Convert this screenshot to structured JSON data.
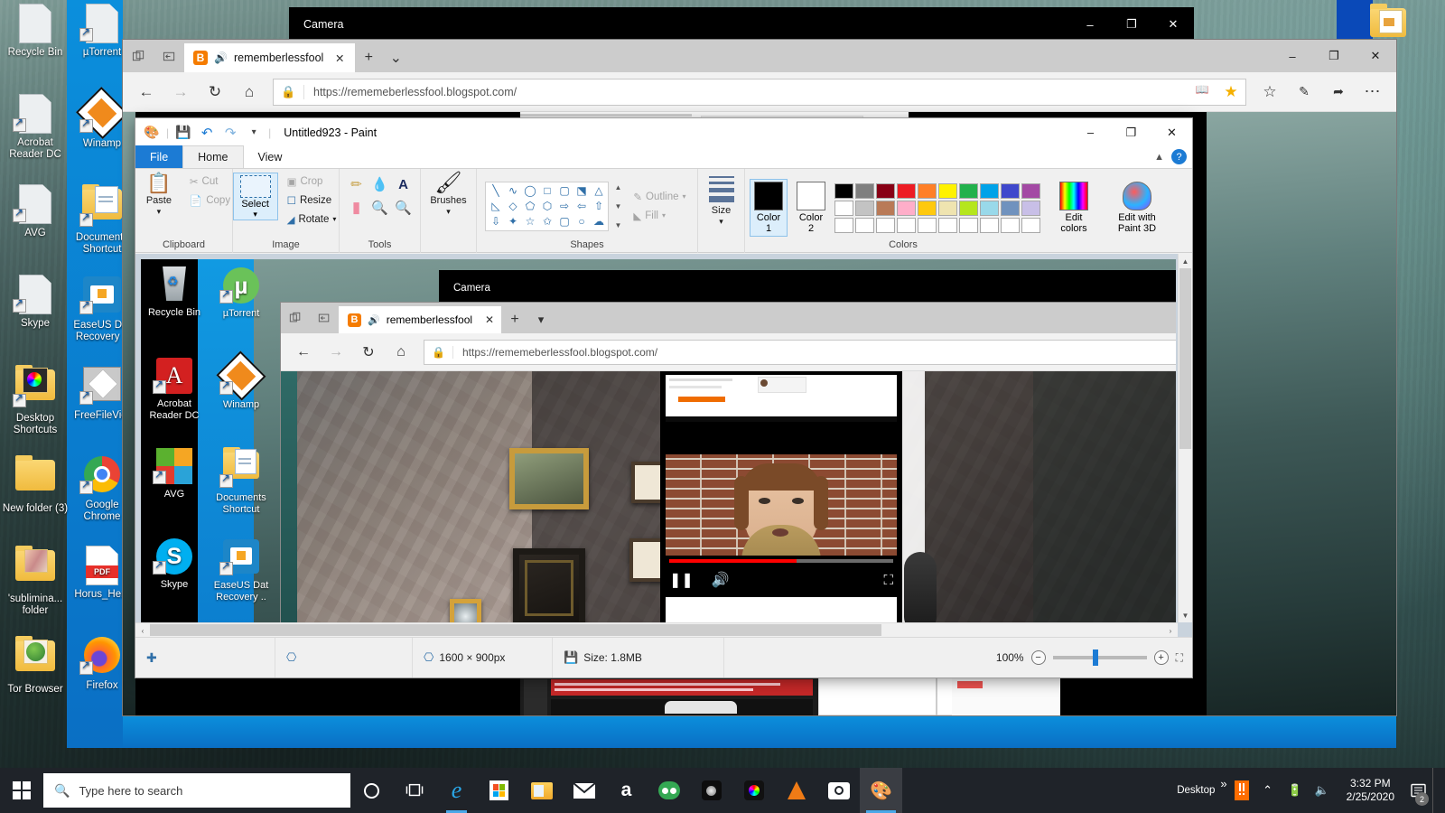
{
  "desktop": {
    "icons_col1": [
      {
        "label": "Recycle Bin",
        "icon": "recycle-bin-icon"
      },
      {
        "label": "Acrobat Reader DC",
        "icon": "acrobat-reader-icon"
      },
      {
        "label": "AVG",
        "icon": "avg-icon"
      },
      {
        "label": "Skype",
        "icon": "skype-icon"
      },
      {
        "label": "Desktop Shortcuts",
        "icon": "folder-icon"
      },
      {
        "label": "New folder (3)",
        "icon": "folder-icon"
      },
      {
        "label": "'sublimina... folder",
        "icon": "folder-icon"
      },
      {
        "label": "Tor Browser",
        "icon": "tor-browser-icon"
      }
    ],
    "icons_col2": [
      {
        "label": "µTorrent",
        "icon": "utorrent-icon"
      },
      {
        "label": "Winamp",
        "icon": "winamp-icon"
      },
      {
        "label": "Documents Shortcut",
        "icon": "documents-folder-icon"
      },
      {
        "label": "EaseUS Dat Recovery ..",
        "icon": "easeus-icon"
      },
      {
        "label": "FreeFileVie.",
        "icon": "freefileviewer-icon"
      },
      {
        "label": "Google Chrome",
        "icon": "chrome-icon"
      },
      {
        "label": "Horus_Her..",
        "icon": "pdf-icon"
      },
      {
        "label": "Firefox",
        "icon": "firefox-icon"
      }
    ],
    "icon_top_right": {
      "label": "",
      "icon": "folder-icon"
    }
  },
  "camera_window": {
    "title": "Camera",
    "minimize": "–",
    "maximize": "❐",
    "close": "✕"
  },
  "edge": {
    "tab_tools": {
      "tab_preview": "tab-preview-icon",
      "set_aside": "set-aside-icon"
    },
    "tab": {
      "favicon": "blogger-icon",
      "audio_icon": "speaker-playing-icon",
      "title": "rememberlessfool",
      "close": "✕"
    },
    "new_tab": "+",
    "tab_dropdown": "⌄",
    "nav": {
      "back": "←",
      "forward": "→",
      "refresh": "↻",
      "home": "⌂"
    },
    "address": {
      "lock_icon": "lock-icon",
      "url": "https://rememeberlessfool.blogspot.com/",
      "reading_view_icon": "reading-view-icon",
      "favorite_icon": "star-filled-icon"
    },
    "toolbar": {
      "favorites_icon": "favorites-hub-icon",
      "notes_icon": "make-a-note-icon",
      "share_icon": "share-icon",
      "more_icon": "more-settings-icon"
    },
    "window_controls": {
      "minimize": "–",
      "maximize": "❐",
      "close": "✕"
    }
  },
  "paint": {
    "title": "Untitled923 - Paint",
    "qat": [
      "paint-app-icon",
      "save-icon",
      "undo-icon",
      "redo-icon",
      "customize-qat-icon"
    ],
    "window_controls": {
      "minimize": "–",
      "maximize": "❐",
      "close": "✕"
    },
    "ribbon_collapse_icon": "chevron-up-icon",
    "help_icon": "?",
    "tabs": [
      {
        "label": "File",
        "state": "file"
      },
      {
        "label": "Home",
        "state": "active"
      },
      {
        "label": "View",
        "state": "normal"
      }
    ],
    "groups": {
      "clipboard": {
        "name": "Clipboard",
        "paste": "Paste",
        "cut": "Cut",
        "copy": "Copy"
      },
      "image": {
        "name": "Image",
        "select": "Select",
        "crop": "Crop",
        "resize": "Resize",
        "rotate": "Rotate"
      },
      "tools": {
        "name": "Tools",
        "items": [
          "pencil-icon",
          "fill-with-color-icon",
          "text-icon",
          "eraser-icon",
          "color-picker-icon",
          "magnifier-icon"
        ]
      },
      "brushes": {
        "name": "",
        "label": "Brushes"
      },
      "shapes": {
        "name": "Shapes",
        "glyphs": [
          "╲",
          "∿",
          "◯",
          "□",
          "▢",
          "⬔",
          "△",
          "◺",
          "◇",
          "⬠",
          "⬡",
          "⇨",
          "⇦",
          "⇧",
          "⇩",
          "✦",
          "☆",
          "✩",
          "▢",
          "○",
          "☁"
        ],
        "outline": "Outline",
        "fill": "Fill"
      },
      "size": {
        "name": "",
        "label": "Size"
      },
      "colors": {
        "name": "Colors",
        "color1_label": "Color 1",
        "color2_label": "Color 2",
        "color1_value": "#000000",
        "color2_value": "#ffffff",
        "edit_colors": "Edit colors",
        "edit_paint3d": "Edit with Paint 3D",
        "row1": [
          "#000000",
          "#7f7f7f",
          "#880015",
          "#ed1c24",
          "#ff7f27",
          "#fff200",
          "#22b14c",
          "#00a2e8",
          "#3f48cc",
          "#a349a4"
        ],
        "row2": [
          "#ffffff",
          "#c3c3c3",
          "#b97a57",
          "#ffaec9",
          "#ffc90e",
          "#efe4b0",
          "#b5e61d",
          "#99d9ea",
          "#7092be",
          "#c8bfe7"
        ],
        "row3": [
          "#ffffff",
          "#ffffff",
          "#ffffff",
          "#ffffff",
          "#ffffff",
          "#ffffff",
          "#ffffff",
          "#ffffff",
          "#ffffff",
          "#ffffff"
        ]
      }
    },
    "status": {
      "cursor_pos_icon": "cursor-position-icon",
      "selection_icon": "selection-size-icon",
      "image_size_icon": "image-size-icon",
      "image_size": "1600 × 900px",
      "file_size_icon": "file-size-icon",
      "file_size": "Size: 1.8MB",
      "zoom_level": "100%",
      "zoom_out": "−",
      "zoom_in": "+",
      "fit_icon": "fit-to-window-icon"
    },
    "scroll": {
      "up": "▲",
      "down": "▼",
      "left": "‹",
      "right": "›"
    }
  },
  "inner_screenshot": {
    "camera_title": "Camera",
    "edge_tab_title": "rememberlessfool",
    "edge_url": "https://rememeberlessfool.blogspot.com/",
    "icons_col1": [
      "Recycle Bin",
      "Acrobat Reader DC",
      "AVG",
      "Skype"
    ],
    "icons_col2": [
      "µTorrent",
      "Winamp",
      "Documents Shortcut",
      "EaseUS Dat Recovery .."
    ],
    "video": {
      "play_pause": "pause-icon",
      "volume": "volume-icon",
      "fullscreen": "fullscreen-icon",
      "progress_percent": 57,
      "progress_color": "#ff0000"
    }
  },
  "taskbar": {
    "start": "start-button-icon",
    "search_placeholder": "Type here to search",
    "search_icon": "search-icon",
    "cortana": "cortana-icon",
    "task_view": "task-view-icon",
    "pinned": [
      {
        "name": "edge-taskbar-icon",
        "label": "e"
      },
      {
        "name": "microsoft-store-icon",
        "label": ""
      },
      {
        "name": "file-explorer-icon",
        "label": ""
      },
      {
        "name": "mail-icon",
        "label": ""
      },
      {
        "name": "amazon-icon",
        "label": "a"
      },
      {
        "name": "tripadvisor-icon",
        "label": ""
      },
      {
        "name": "app-dark-icon",
        "label": ""
      },
      {
        "name": "app-color-icon",
        "label": ""
      },
      {
        "name": "vlc-icon",
        "label": ""
      },
      {
        "name": "camera-taskbar-icon",
        "label": ""
      },
      {
        "name": "paint-taskbar-icon",
        "label": ""
      }
    ],
    "tray": {
      "desktop_label": "Desktop",
      "overflow": "»",
      "show_hidden": "⌃",
      "avg_icon": "avg-tray-icon",
      "battery_icon": "battery-icon",
      "volume_icon": "volume-tray-icon",
      "time": "3:32 PM",
      "date": "2/25/2020",
      "action_center": "action-center-icon",
      "notification_count": "2"
    }
  }
}
